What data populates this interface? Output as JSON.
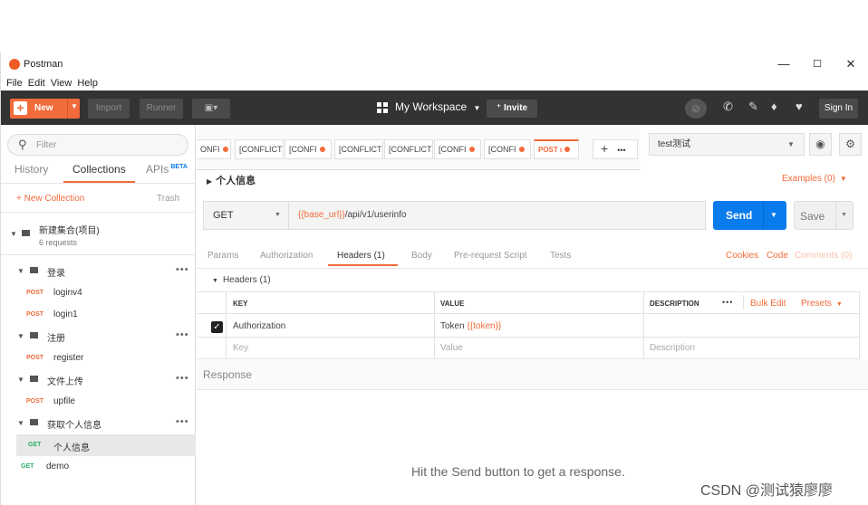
{
  "window": {
    "title": "Postman",
    "controls": {
      "minimize": "—",
      "maximize": "☐",
      "close": "✕"
    }
  },
  "menu": [
    "File",
    "Edit",
    "View",
    "Help"
  ],
  "toolbar": {
    "new_label": "New",
    "import_label": "Import",
    "runner_label": "Runner",
    "workspace_label": "My Workspace",
    "invite_label": "Invite",
    "signin_label": "Sign In"
  },
  "sidebar": {
    "filter_placeholder": "Filter",
    "tabs": {
      "history": "History",
      "collections": "Collections",
      "apis": "APIs",
      "beta": "BETA"
    },
    "new_collection": "+ New Collection",
    "trash": "Trash",
    "collection": {
      "name": "新建集合(项目)",
      "count": "6 requests"
    },
    "items": [
      {
        "kind": "folder",
        "label": "登录"
      },
      {
        "kind": "request",
        "method": "POST",
        "label": "loginv4"
      },
      {
        "kind": "request",
        "method": "POST",
        "label": "login1"
      },
      {
        "kind": "folder",
        "label": "注册"
      },
      {
        "kind": "request",
        "method": "POST",
        "label": "register"
      },
      {
        "kind": "folder",
        "label": "文件上传"
      },
      {
        "kind": "request",
        "method": "POST",
        "label": "upfile"
      },
      {
        "kind": "folder",
        "label": "获取个人信息"
      },
      {
        "kind": "request",
        "method": "GET",
        "label": "个人信息",
        "selected": true
      },
      {
        "kind": "request",
        "method": "GET",
        "label": "demo"
      }
    ]
  },
  "tabs": {
    "items": [
      "ONFI",
      "[CONFLICT",
      "[CONFI",
      "[CONFLICT",
      "[CONFLICT",
      "[CONFI",
      "[CONFI",
      "POST ι"
    ],
    "add": "+",
    "more": "•••"
  },
  "environment": {
    "selected": "test测试"
  },
  "request": {
    "name": "个人信息",
    "examples": "Examples (0)",
    "method": "GET",
    "url_var": "{{base_url}}",
    "url_path": "/api/v1/userinfo",
    "send_label": "Send",
    "save_label": "Save"
  },
  "subtabs": {
    "params": "Params",
    "authorization": "Authorization",
    "headers": "Headers (1)",
    "body": "Body",
    "prerequest": "Pre-request Script",
    "tests": "Tests",
    "cookies": "Cookies",
    "code": "Code",
    "comments": "Comments (0)"
  },
  "headers": {
    "section_label": "Headers (1)",
    "columns": {
      "key": "KEY",
      "value": "VALUE",
      "description": "DESCRIPTION"
    },
    "more": "•••",
    "bulk_edit": "Bulk Edit",
    "presets": "Presets",
    "row": {
      "key": "Authorization",
      "value_prefix": "Token ",
      "value_var": "{{token}}"
    },
    "placeholders": {
      "key": "Key",
      "value": "Value",
      "description": "Description"
    }
  },
  "response": {
    "label": "Response",
    "hint": "Hit the Send button to get a response."
  },
  "watermark": "CSDN @测试猿廖廖",
  "colors": {
    "accent": "#f26b3a",
    "send": "#097bed",
    "toolbar": "#333333",
    "get": "#2bae66"
  }
}
